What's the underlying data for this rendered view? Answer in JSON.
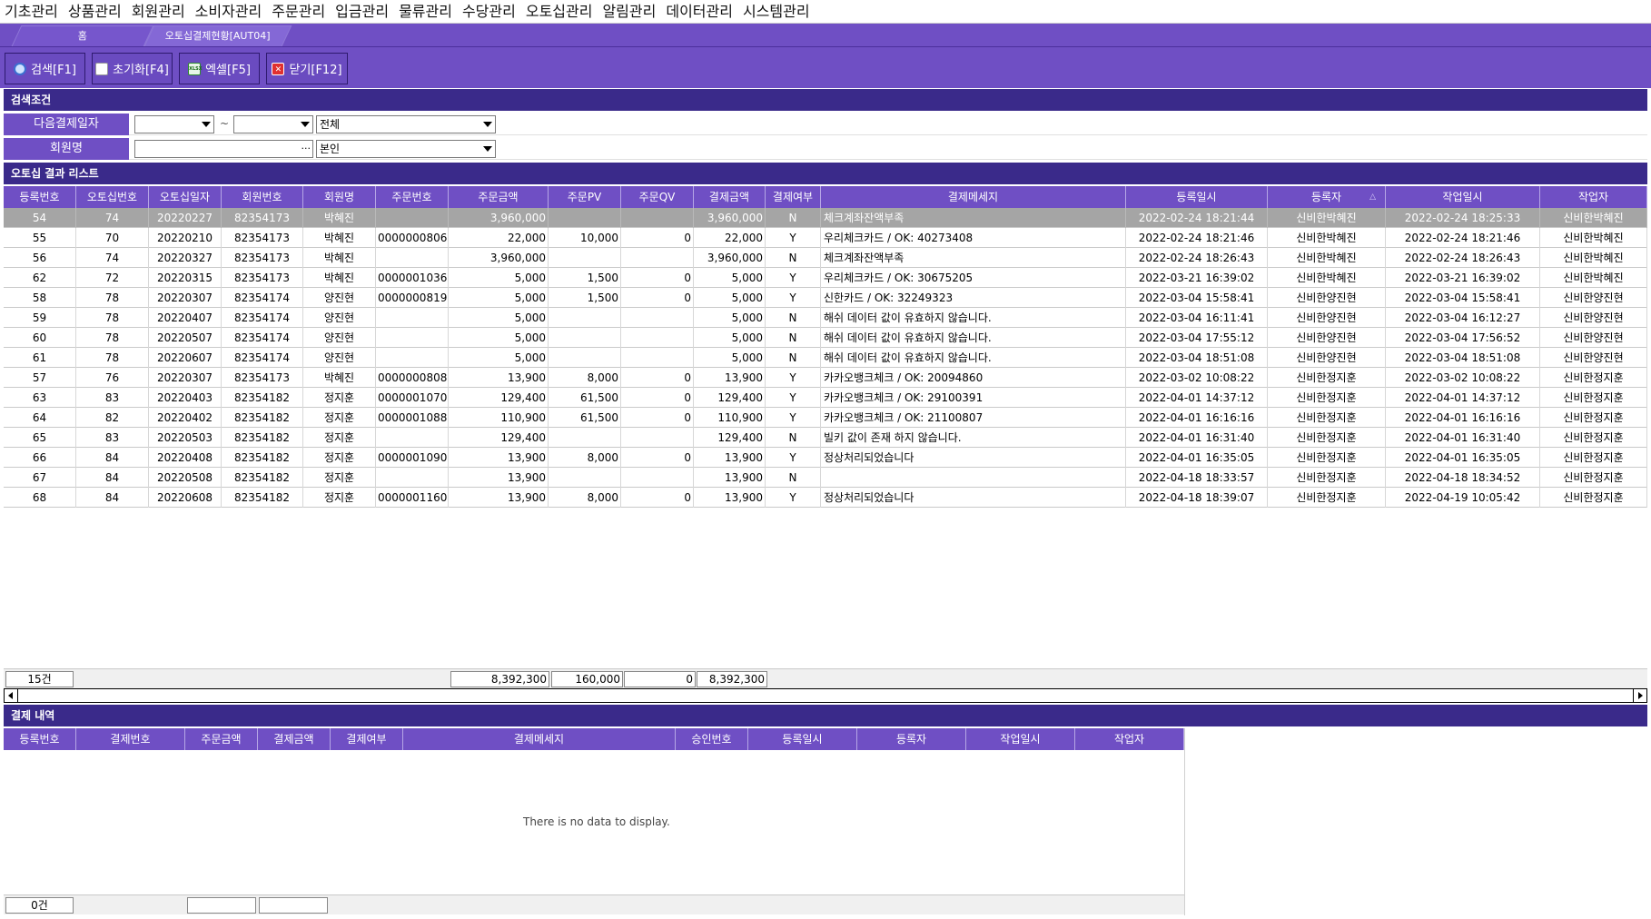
{
  "menu": [
    "기초관리",
    "상품관리",
    "회원관리",
    "소비자관리",
    "주문관리",
    "입금관리",
    "물류관리",
    "수당관리",
    "오토십관리",
    "알림관리",
    "데이터관리",
    "시스템관리"
  ],
  "tabs": {
    "home": "홈",
    "active": "오토십결제현황[AUT04]"
  },
  "toolbar": {
    "search": "검색[F1]",
    "reset": "초기화[F4]",
    "excel": "엑셀[F5]",
    "close": "닫기[F12]",
    "excel_icon_text": "XLSX"
  },
  "search": {
    "title": "검색조건",
    "date_label": "다음결제일자",
    "date_from": "",
    "date_to": "",
    "tilde": "~",
    "status_value": "전체",
    "member_label": "회원명",
    "member_value": "",
    "member_scope": "본인"
  },
  "results": {
    "title": "오토십 결과 리스트",
    "columns": [
      "등록번호",
      "오토십번호",
      "오토십일자",
      "회원번호",
      "회원명",
      "주문번호",
      "주문금액",
      "주문PV",
      "주문QV",
      "결제금액",
      "결제여부",
      "결제메세지",
      "등록일시",
      "등록자",
      "작업일시",
      "작업자"
    ],
    "sort_indicator": "△",
    "rows": [
      [
        "54",
        "74",
        "20220227",
        "82354173",
        "박혜진",
        "",
        "3,960,000",
        "",
        "",
        "3,960,000",
        "N",
        "체크계좌잔액부족",
        "2022-02-24 18:21:44",
        "신비한박혜진",
        "2022-02-24 18:25:33",
        "신비한박혜진"
      ],
      [
        "55",
        "70",
        "20220210",
        "82354173",
        "박혜진",
        "0000000806",
        "22,000",
        "10,000",
        "0",
        "22,000",
        "Y",
        "우리체크카드 / OK: 40273408",
        "2022-02-24 18:21:46",
        "신비한박혜진",
        "2022-02-24 18:21:46",
        "신비한박혜진"
      ],
      [
        "56",
        "74",
        "20220327",
        "82354173",
        "박혜진",
        "",
        "3,960,000",
        "",
        "",
        "3,960,000",
        "N",
        "체크계좌잔액부족",
        "2022-02-24 18:26:43",
        "신비한박혜진",
        "2022-02-24 18:26:43",
        "신비한박혜진"
      ],
      [
        "62",
        "72",
        "20220315",
        "82354173",
        "박혜진",
        "0000001036",
        "5,000",
        "1,500",
        "0",
        "5,000",
        "Y",
        "우리체크카드 / OK: 30675205",
        "2022-03-21 16:39:02",
        "신비한박혜진",
        "2022-03-21 16:39:02",
        "신비한박혜진"
      ],
      [
        "58",
        "78",
        "20220307",
        "82354174",
        "양진현",
        "0000000819",
        "5,000",
        "1,500",
        "0",
        "5,000",
        "Y",
        "신한카드 / OK: 32249323",
        "2022-03-04 15:58:41",
        "신비한양진현",
        "2022-03-04 15:58:41",
        "신비한양진현"
      ],
      [
        "59",
        "78",
        "20220407",
        "82354174",
        "양진현",
        "",
        "5,000",
        "",
        "",
        "5,000",
        "N",
        "해쉬 데이터 값이 유효하지 않습니다.",
        "2022-03-04 16:11:41",
        "신비한양진현",
        "2022-03-04 16:12:27",
        "신비한양진현"
      ],
      [
        "60",
        "78",
        "20220507",
        "82354174",
        "양진현",
        "",
        "5,000",
        "",
        "",
        "5,000",
        "N",
        "해쉬 데이터 값이 유효하지 않습니다.",
        "2022-03-04 17:55:12",
        "신비한양진현",
        "2022-03-04 17:56:52",
        "신비한양진현"
      ],
      [
        "61",
        "78",
        "20220607",
        "82354174",
        "양진현",
        "",
        "5,000",
        "",
        "",
        "5,000",
        "N",
        "해쉬 데이터 값이 유효하지 않습니다.",
        "2022-03-04 18:51:08",
        "신비한양진현",
        "2022-03-04 18:51:08",
        "신비한양진현"
      ],
      [
        "57",
        "76",
        "20220307",
        "82354173",
        "박혜진",
        "0000000808",
        "13,900",
        "8,000",
        "0",
        "13,900",
        "Y",
        "카카오뱅크체크 / OK: 20094860",
        "2022-03-02 10:08:22",
        "신비한정지훈",
        "2022-03-02 10:08:22",
        "신비한정지훈"
      ],
      [
        "63",
        "83",
        "20220403",
        "82354182",
        "정지훈",
        "0000001070",
        "129,400",
        "61,500",
        "0",
        "129,400",
        "Y",
        "카카오뱅크체크 / OK: 29100391",
        "2022-04-01 14:37:12",
        "신비한정지훈",
        "2022-04-01 14:37:12",
        "신비한정지훈"
      ],
      [
        "64",
        "82",
        "20220402",
        "82354182",
        "정지훈",
        "0000001088",
        "110,900",
        "61,500",
        "0",
        "110,900",
        "Y",
        "카카오뱅크체크 / OK: 21100807",
        "2022-04-01 16:16:16",
        "신비한정지훈",
        "2022-04-01 16:16:16",
        "신비한정지훈"
      ],
      [
        "65",
        "83",
        "20220503",
        "82354182",
        "정지훈",
        "",
        "129,400",
        "",
        "",
        "129,400",
        "N",
        "빌키 값이 존재 하지 않습니다.",
        "2022-04-01 16:31:40",
        "신비한정지훈",
        "2022-04-01 16:31:40",
        "신비한정지훈"
      ],
      [
        "66",
        "84",
        "20220408",
        "82354182",
        "정지훈",
        "0000001090",
        "13,900",
        "8,000",
        "0",
        "13,900",
        "Y",
        "정상처리되었습니다",
        "2022-04-01 16:35:05",
        "신비한정지훈",
        "2022-04-01 16:35:05",
        "신비한정지훈"
      ],
      [
        "67",
        "84",
        "20220508",
        "82354182",
        "정지훈",
        "",
        "13,900",
        "",
        "",
        "13,900",
        "N",
        "",
        "2022-04-18 18:33:57",
        "신비한정지훈",
        "2022-04-18 18:34:52",
        "신비한정지훈"
      ],
      [
        "68",
        "84",
        "20220608",
        "82354182",
        "정지훈",
        "0000001160",
        "13,900",
        "8,000",
        "0",
        "13,900",
        "Y",
        "정상처리되었습니다",
        "2022-04-18 18:39:07",
        "신비한정지훈",
        "2022-04-19 10:05:42",
        "신비한정지훈"
      ]
    ],
    "footer": {
      "count": "15건",
      "order_amount": "8,392,300",
      "order_pv": "160,000",
      "order_qv": "0",
      "pay_amount": "8,392,300"
    }
  },
  "payments": {
    "title": "결제 내역",
    "columns": [
      "등록번호",
      "결제번호",
      "주문금액",
      "결제금액",
      "결제여부",
      "결제메세지",
      "승인번호",
      "등록일시",
      "등록자",
      "작업일시",
      "작업자"
    ],
    "empty_text": "There is no data to display.",
    "footer": {
      "count": "0건",
      "order_amount": "",
      "pay_amount": ""
    }
  },
  "colors": {
    "menu_bg": "#ffffff",
    "purple": "#6f4fc4",
    "section_dark": "#3a2a8a",
    "selected_row": "#a5a5a5"
  }
}
